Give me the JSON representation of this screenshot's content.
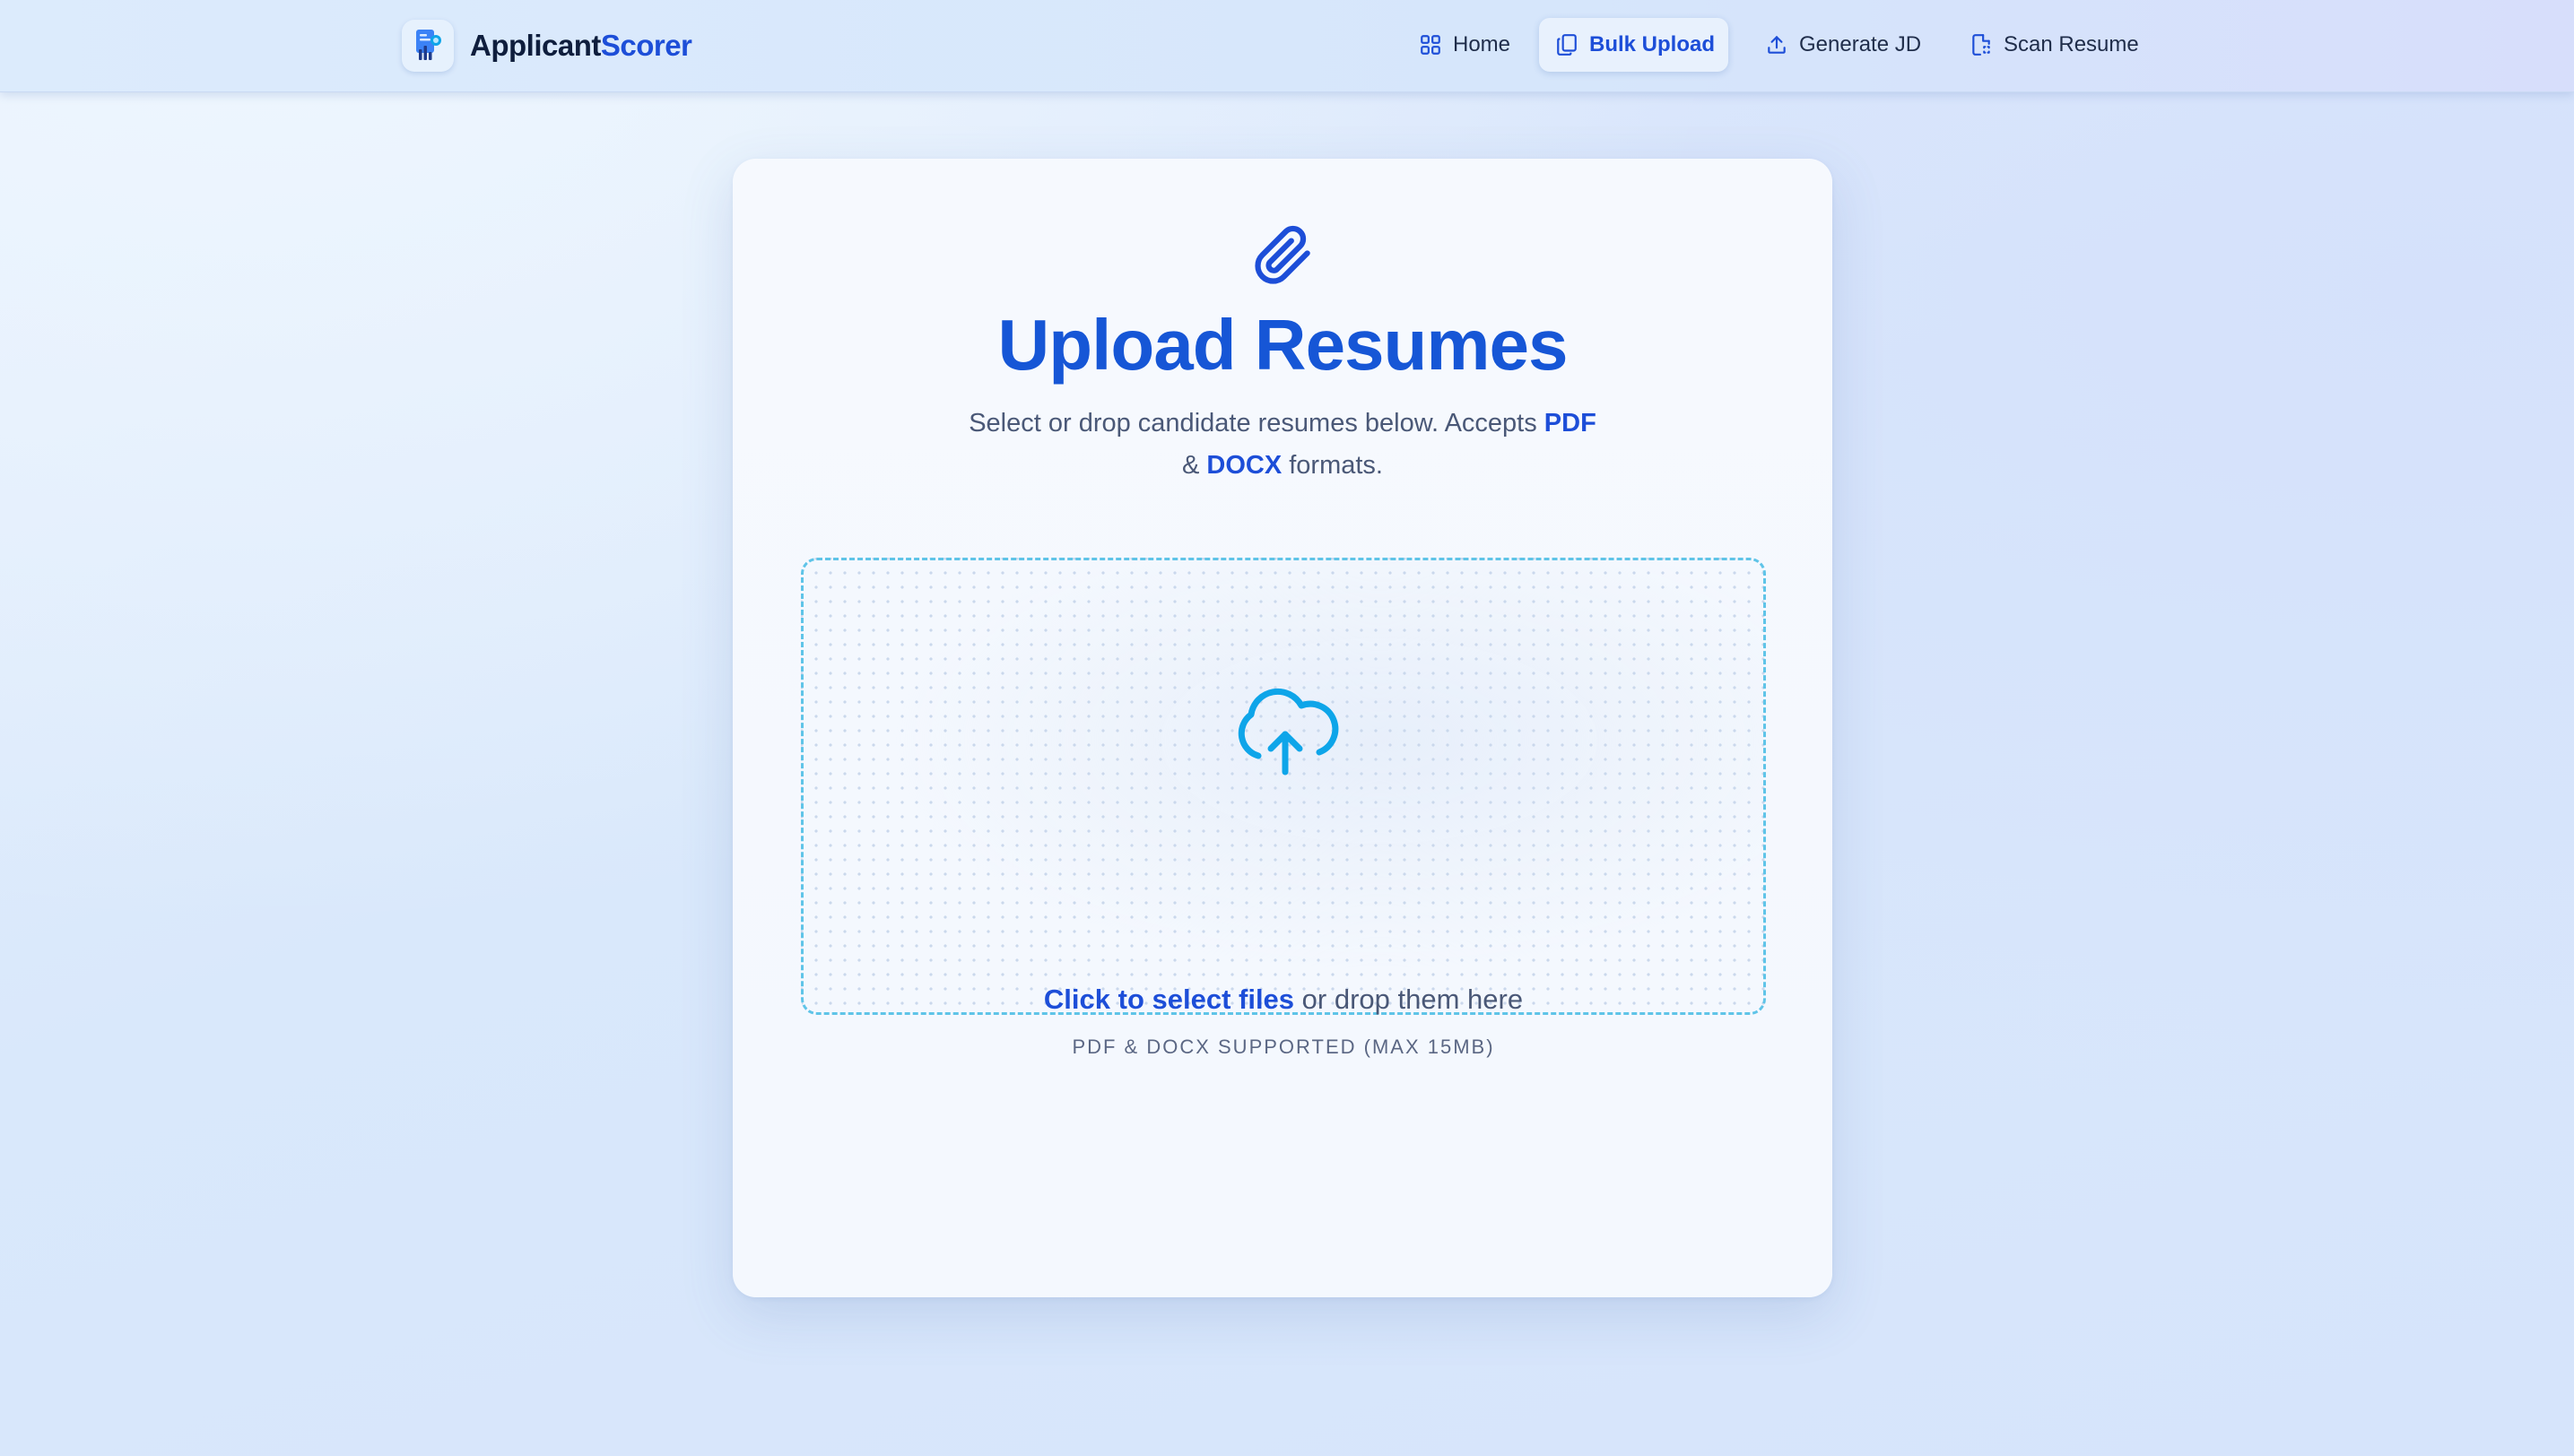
{
  "brand": {
    "name_part1": "Applicant",
    "name_part2": "Scorer",
    "logo_icon": "resume-chart-icon"
  },
  "nav": {
    "items": [
      {
        "label": "Home",
        "icon": "grid-icon",
        "active": false
      },
      {
        "label": "Bulk Upload",
        "icon": "copy-documents-icon",
        "active": true
      },
      {
        "label": "Generate JD",
        "icon": "upload-icon",
        "active": false
      },
      {
        "label": "Scan Resume",
        "icon": "scan-document-icon",
        "active": false
      }
    ]
  },
  "main": {
    "icon": "paperclip-icon",
    "title": "Upload Resumes",
    "subtitle_prefix": "Select or drop candidate resumes below. Accepts ",
    "subtitle_format1": "PDF",
    "subtitle_and": " & ",
    "subtitle_format2": "DOCX",
    "subtitle_suffix": " formats."
  },
  "dropzone": {
    "icon": "cloud-upload-icon",
    "link_text": "Click to select files",
    "rest_text": " or drop them here",
    "hint": "PDF & DOCX SUPPORTED (MAX 15MB)"
  },
  "colors": {
    "primary": "#1d4ed8",
    "title": "#1656d6",
    "accent_cyan": "#0ea5e9",
    "dropzone_border": "#5fc4e8",
    "text_muted": "#4a5877"
  }
}
